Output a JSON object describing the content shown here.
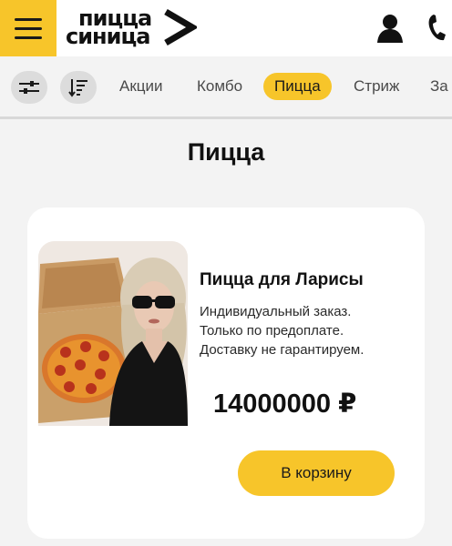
{
  "header": {
    "logo_line1": "пицца",
    "logo_line2": "синица"
  },
  "nav": {
    "tabs": [
      {
        "label": "Акции"
      },
      {
        "label": "Комбо"
      },
      {
        "label": "Пицца",
        "active": true
      },
      {
        "label": "Стриж"
      },
      {
        "label": "За"
      }
    ]
  },
  "page": {
    "title": "Пицца"
  },
  "product": {
    "name": "Пицца для Ларисы",
    "description_lines": [
      "Индивидуальный заказ.",
      "Только по предоплате.",
      "Доставку не гарантируем."
    ],
    "price": "14000000 ₽",
    "cart_button_label": "В корзину"
  },
  "colors": {
    "accent": "#f7c52a",
    "background": "#f3f3f3",
    "card": "#ffffff"
  },
  "icons": [
    "menu-icon",
    "logo-arrow-icon",
    "user-icon",
    "phone-icon",
    "filter-settings-icon",
    "sort-icon"
  ]
}
